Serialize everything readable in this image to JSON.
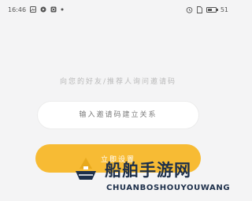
{
  "status_bar": {
    "time": "16:46",
    "battery": "51",
    "left_icons": [
      "image-notification-icon",
      "play-notification-icon",
      "sync-icon",
      "dot-icon"
    ],
    "right_icons": [
      "alarm-icon",
      "sim-icon",
      "battery-icon"
    ]
  },
  "invite": {
    "prompt": "向您的好友/推荐人询问邀请码",
    "input_placeholder": "输入邀请码建立关系",
    "input_value": "",
    "confirm_label": "立即设置"
  },
  "watermark": {
    "title": "船舶手游网",
    "subtitle": "CHUANBOSHOUYOUWANG"
  },
  "colors": {
    "accent": "#f7bb34",
    "background": "#f4f4f5"
  }
}
